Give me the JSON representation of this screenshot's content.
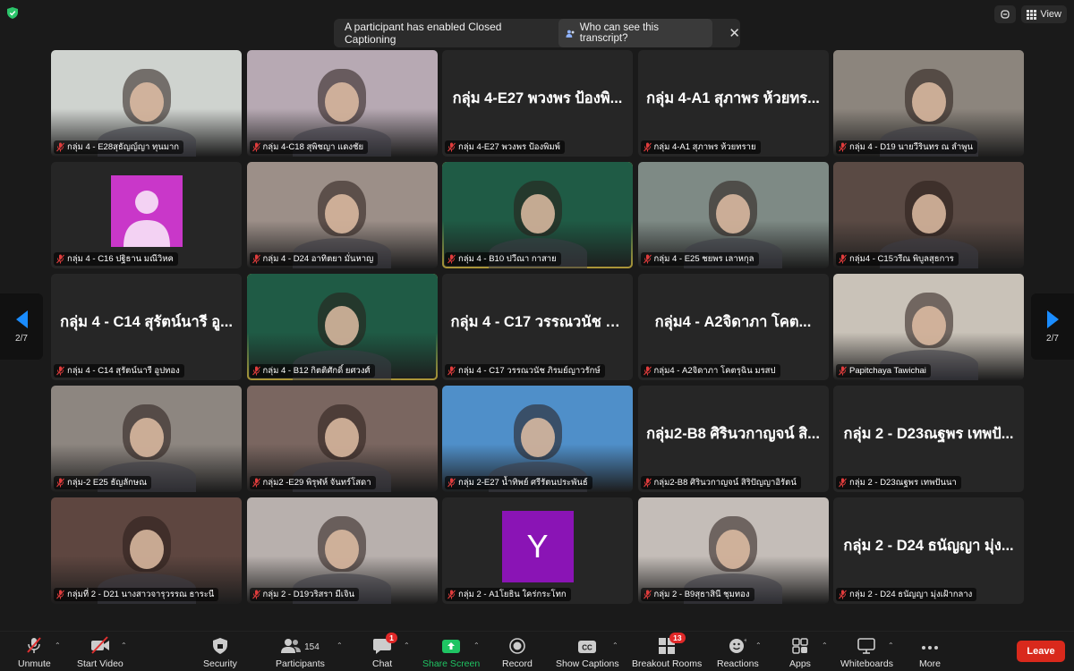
{
  "banner": {
    "text": "A participant has enabled Closed Captioning",
    "who_button": "Who can see this transcript?",
    "close": "✕"
  },
  "top_right": {
    "view_label": "View"
  },
  "pagination": {
    "left": "2/7",
    "right": "2/7"
  },
  "tiles": [
    {
      "label": "กลุ่ม 4 - E28สุธัญญ์ญา ทุนมาก",
      "big": "",
      "kind": "video",
      "bg": "#cfd3cf"
    },
    {
      "label": "กลุ่ม 4-C18 สุพิชญา แดงชัย",
      "big": "",
      "kind": "video",
      "bg": "#b7a9b3"
    },
    {
      "label": "กลุ่ม 4-E27 พวงพร ป้องพิมพ์",
      "big": "กลุ่ม 4-E27 พวงพร ป้องพิ...",
      "kind": "name"
    },
    {
      "label": "กลุ่ม 4-A1 สุภาพร ห้วยทราย",
      "big": "กลุ่ม 4-A1 สุภาพร ห้วยทร...",
      "kind": "name"
    },
    {
      "label": "กลุ่ม 4 - D19 นายวีรินทร ณ ลำพูน",
      "big": "",
      "kind": "video",
      "bg": "#8c857d"
    },
    {
      "label": "กลุ่ม 4 - C16 ปฐิธาน มณีวิหค",
      "big": "",
      "kind": "avatar-pink"
    },
    {
      "label": "กลุ่ม 4 - D24 อาทิตยา มั่นหาญ",
      "big": "",
      "kind": "video",
      "bg": "#9c8f88"
    },
    {
      "label": "กลุ่ม 4 - B10 ปวีณา กาสาย",
      "big": "",
      "kind": "video",
      "bg": "#1f5b45",
      "active": true
    },
    {
      "label": "กลุ่ม 4 - E25 ชยพร เลาหกุล",
      "big": "",
      "kind": "video",
      "bg": "#7e8a85"
    },
    {
      "label": "กลุ่ม4 - C15วรีณ พิบูลสุธการ",
      "big": "",
      "kind": "video",
      "bg": "#5a4a44"
    },
    {
      "label": "กลุ่ม 4 - C14 สุรัตน์นารี อูปทอง",
      "big": "กลุ่ม 4 - C14 สุรัตน์นารี อู...",
      "kind": "name"
    },
    {
      "label": "กลุ่ม 4 - B12 กิตติศักดิ์ ยศวงศ์",
      "big": "",
      "kind": "video",
      "bg": "#1f5b45",
      "active": true
    },
    {
      "label": "กลุ่ม 4 - C17 วรรณวนัช ภิรมย์ญาวรักษ์",
      "big": "กลุ่ม 4 - C17 วรรณวนัช ภิ...",
      "kind": "name"
    },
    {
      "label": "กลุ่ม4 - A2จิดาภา โคตรุฉิน มรสป",
      "big": "กลุ่ม4 - A2จิดาภา โคต...",
      "kind": "name"
    },
    {
      "label": "Papitchaya Tawichai",
      "big": "",
      "kind": "video",
      "bg": "#c9c2b8"
    },
    {
      "label": "กลุ่ม-2 E25 ธัญลักษณ",
      "big": "",
      "kind": "video",
      "bg": "#8d8680"
    },
    {
      "label": "กลุ่ม2 -E29 พิรุฬห์ จันทร์โสดา",
      "big": "",
      "kind": "video",
      "bg": "#7a6660"
    },
    {
      "label": "กลุ่ม 2-E27 น้ำทิพย์ ศรีรัตนประพันธ์",
      "big": "",
      "kind": "video",
      "bg": "#4f8fc9"
    },
    {
      "label": "กลุ่ม2-B8 ศิรินวกาญจน์ สิริปัญญาอิรัตน์",
      "big": "กลุ่ม2-B8 ศิรินวกาญจน์ สิ...",
      "kind": "name"
    },
    {
      "label": "กลุ่ม 2 - D23ณฐพร เทพปันนา",
      "big": "กลุ่ม 2 - D23ณฐพร เทพปั...",
      "kind": "name"
    },
    {
      "label": "กลุ่มที่ 2 - D21 นางสาวจารุวรรณ ธาระนี",
      "big": "",
      "kind": "video",
      "bg": "#5e4640"
    },
    {
      "label": "กลุ่ม 2 - D19วริสรา มีเจิน",
      "big": "",
      "kind": "video",
      "bg": "#b8b0ad"
    },
    {
      "label": "กลุ่ม 2 - A1โยธิน ใคร่กระโทก",
      "big": "",
      "kind": "avatar-letter",
      "letter": "Y"
    },
    {
      "label": "กลุ่ม 2 - B9สุธาสินี ชุมทอง",
      "big": "",
      "kind": "video",
      "bg": "#c4bdb8"
    },
    {
      "label": "กลุ่ม 2 - D24 ธนัญญา มุ่งเฝ้ากลาง",
      "big": "กลุ่ม 2 - D24 ธนัญญา มุ่ง...",
      "kind": "name"
    }
  ],
  "toolbar": {
    "unmute": "Unmute",
    "start_video": "Start Video",
    "security": "Security",
    "participants": "Participants",
    "participants_count": "154",
    "chat": "Chat",
    "chat_badge": "1",
    "share_screen": "Share Screen",
    "record": "Record",
    "show_captions": "Show Captions",
    "breakout_rooms": "Breakout Rooms",
    "breakout_badge": "13",
    "reactions": "Reactions",
    "apps": "Apps",
    "whiteboards": "Whiteboards",
    "more": "More",
    "leave": "Leave",
    "colors": {
      "share": "#1fc463",
      "leave": "#d9291c",
      "badge": "#e02828",
      "nav_arrow": "#1a8cff"
    }
  }
}
